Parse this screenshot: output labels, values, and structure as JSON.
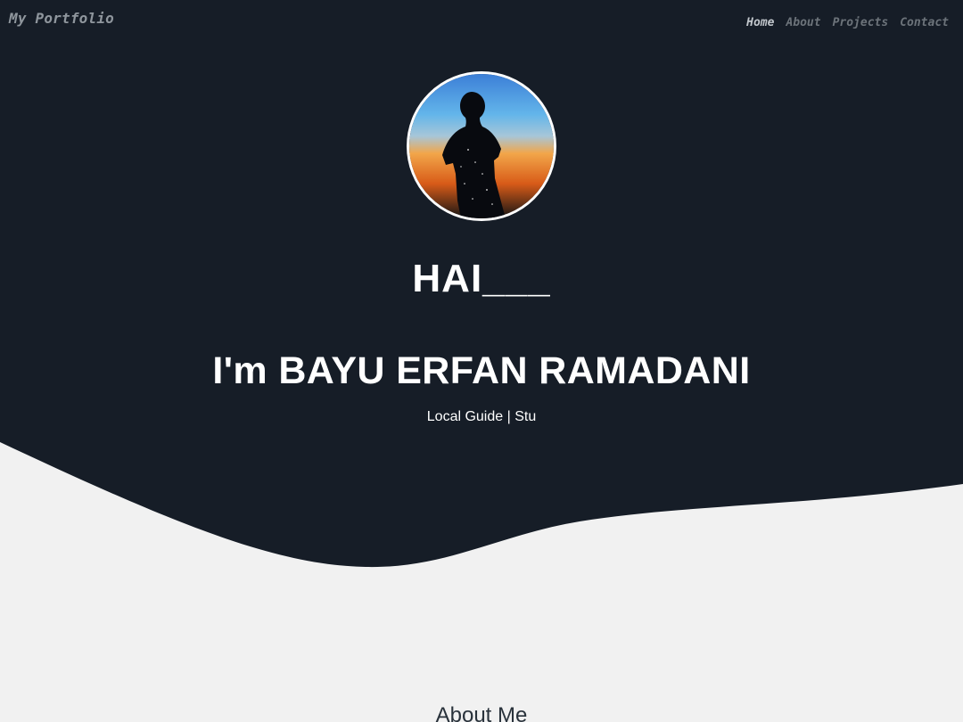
{
  "navbar": {
    "brand": "My Portfolio",
    "links": [
      {
        "label": "Home",
        "active": true
      },
      {
        "label": "About",
        "active": false
      },
      {
        "label": "Projects",
        "active": false
      },
      {
        "label": "Contact",
        "active": false
      }
    ]
  },
  "hero": {
    "greeting": "HAI___",
    "name": "I'm BAYU ERFAN RAMADANI",
    "tagline": "Local Guide | Stu",
    "avatar_icon": "profile-silhouette-sunset"
  },
  "about": {
    "title": "About Me"
  },
  "colors": {
    "hero_background": "#161d27",
    "page_background": "#f1f1f1",
    "text_light": "#ffffff",
    "nav_active": "#c2c7cc",
    "nav_inactive": "#6c737a"
  }
}
